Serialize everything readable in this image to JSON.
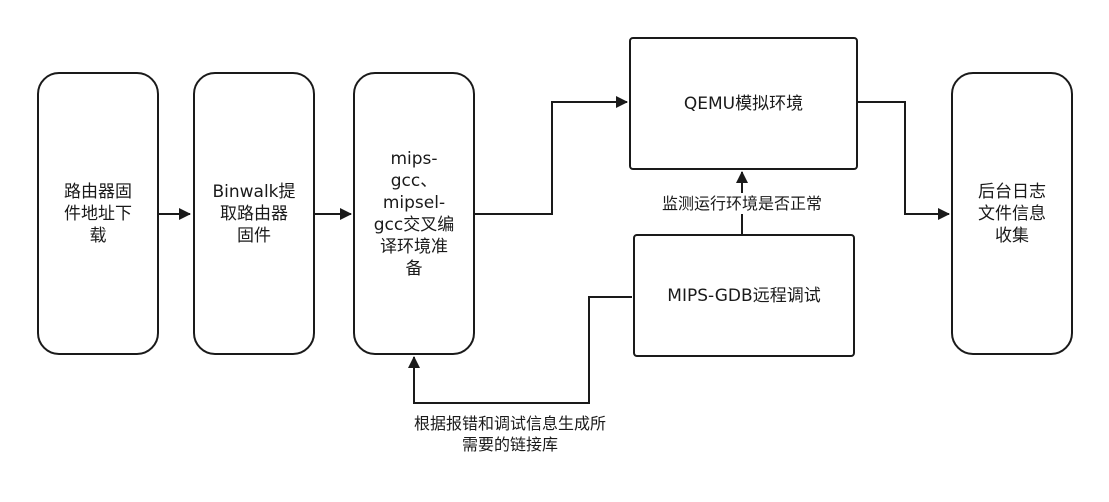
{
  "nodes": {
    "router_firmware_download": "路由器固\n件地址下\n载",
    "binwalk_extract": "Binwalk提\n取路由器\n固件",
    "cross_compile_prep": "mips-\ngcc、\nmipsel-\ngcc交叉编\n译环境准\n备",
    "qemu_emulation": "QEMU模拟环境",
    "mips_gdb_debug": "MIPS-GDB远程调试",
    "log_collection": "后台日志\n文件信息\n收集"
  },
  "edge_labels": {
    "monitor_env": "监测运行环境是否正常",
    "generate_libs": "根据报错和调试信息生成所\n需要的链接库"
  },
  "colors": {
    "stroke": "#1a1a1a",
    "background": "#ffffff"
  }
}
